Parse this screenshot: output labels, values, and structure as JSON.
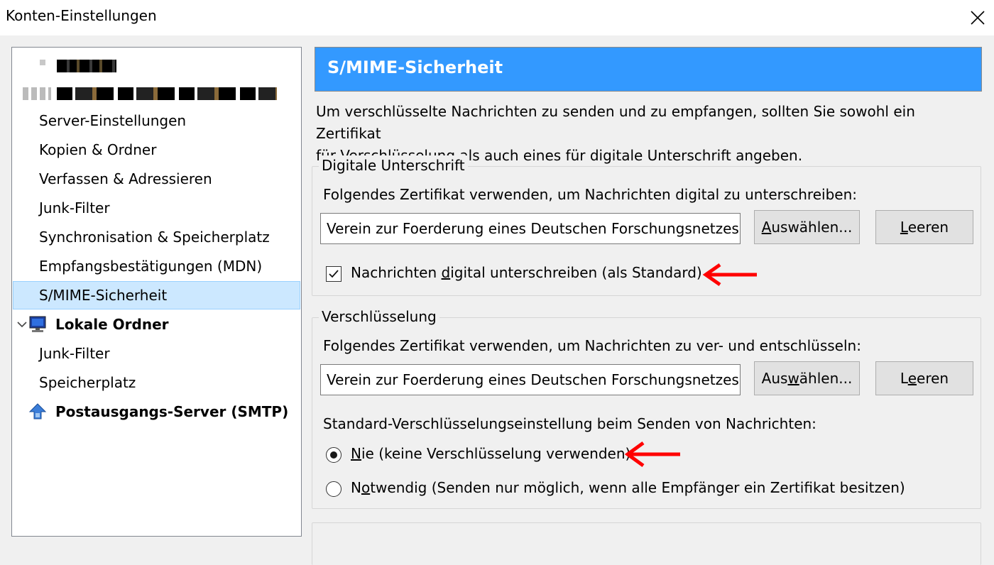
{
  "window": {
    "title": "Konten-Einstellungen"
  },
  "colors": {
    "header_bg": "#3399ff",
    "selected_bg": "#cce8ff",
    "arrow": "#ff0000"
  },
  "tree": {
    "account_items": [
      "Server-Einstellungen",
      "Kopien & Ordner",
      "Verfassen & Adressieren",
      "Junk-Filter",
      "Synchronisation & Speicherplatz",
      "Empfangsbestätigungen (MDN)",
      "S/MIME-Sicherheit"
    ],
    "local_folders": {
      "label": "Lokale Ordner",
      "items": [
        "Junk-Filter",
        "Speicherplatz"
      ]
    },
    "smtp": {
      "label": "Postausgangs-Server (SMTP)"
    }
  },
  "panel": {
    "title": "S/MIME-Sicherheit",
    "intro_line1": "Um verschlüsselte Nachrichten zu senden und zu empfangen, sollten Sie sowohl ein Zertifikat",
    "intro_line2": "für Verschlüsselung als auch eines für digitale Unterschrift angeben.",
    "signing": {
      "legend": "Digitale Unterschrift",
      "description": "Folgendes Zertifikat verwenden, um Nachrichten digital zu unterschreiben:",
      "certificate": "Verein zur Foerderung eines Deutschen Forschungsnetzes e.",
      "select_pre": "",
      "select_key": "A",
      "select_post": "uswählen...",
      "clear_pre": "",
      "clear_key": "L",
      "clear_post": "eeren",
      "checkbox_pre": "Nachrichten ",
      "checkbox_key": "d",
      "checkbox_post": "igital unterschreiben (als Standard)",
      "checkbox_checked": true
    },
    "encryption": {
      "legend": "Verschlüsselung",
      "description": "Folgendes Zertifikat verwenden, um Nachrichten zu ver- und entschlüsseln:",
      "certificate": "Verein zur Foerderung eines Deutschen Forschungsnetzes e.",
      "select_pre": "Aus",
      "select_key": "w",
      "select_post": "ählen...",
      "clear_pre": "L",
      "clear_key": "e",
      "clear_post": "eren",
      "default_label": "Standard-Verschlüsselungseinstellung beim Senden von Nachrichten:",
      "radio_never_key": "N",
      "radio_never_post": "ie (keine Verschlüsselung verwenden)",
      "radio_required_pre": "N",
      "radio_required_key": "o",
      "radio_required_post": "twendig (Senden nur möglich, wenn alle Empfänger ein Zertifikat besitzen)",
      "selected": "never"
    }
  }
}
